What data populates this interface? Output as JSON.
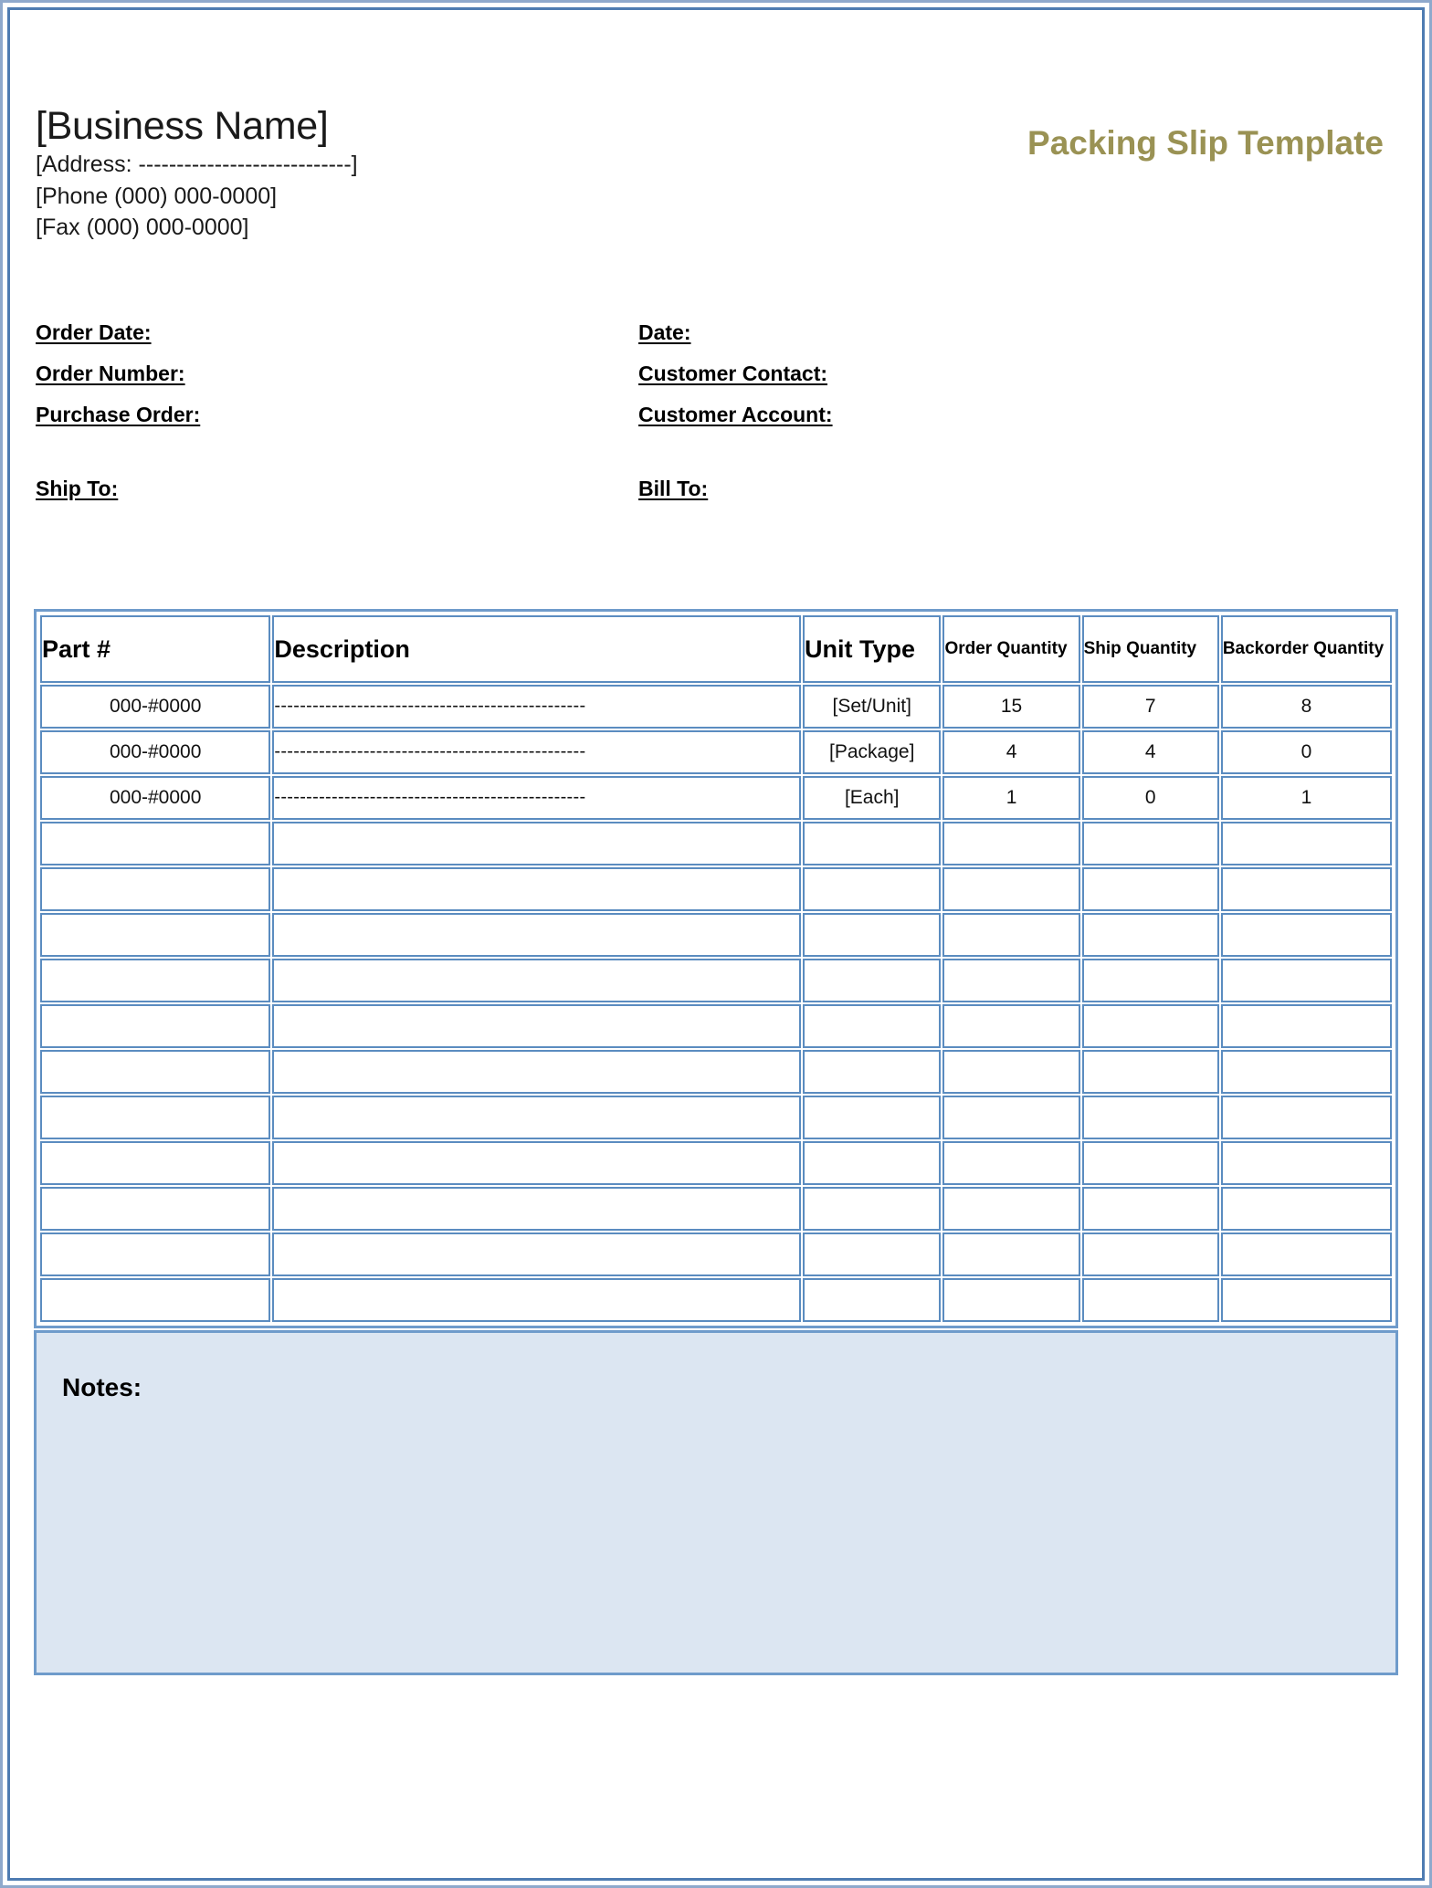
{
  "document": {
    "title": "Packing Slip Template",
    "title_color": "#9a9254"
  },
  "business": {
    "name": "[Business Name]",
    "address": "[Address: ----------------------------]",
    "phone": "[Phone (000) 000-0000]",
    "fax": "[Fax (000) 000-0000]"
  },
  "meta": {
    "left": [
      {
        "label": "Order Date:"
      },
      {
        "label": "Order Number:"
      },
      {
        "label": "Purchase Order:"
      }
    ],
    "right": [
      {
        "label": "Date:"
      },
      {
        "label": "Customer Contact:"
      },
      {
        "label": "Customer Account:"
      }
    ],
    "ship_to": "Ship To:",
    "bill_to": "Bill To:"
  },
  "items_table": {
    "headers": {
      "part": "Part #",
      "description": "Description",
      "unit_type": "Unit Type",
      "order_quantity": "Order Quantity",
      "ship_quantity": "Ship Quantity",
      "backorder_quantity": "Backorder Quantity"
    },
    "header_bg": "#93b4dc",
    "border_color": "#5b8cc0",
    "rows": [
      {
        "part": "000-#0000",
        "description": "-------------------------------------------------",
        "unit_type": "[Set/Unit]",
        "order_quantity": "15",
        "ship_quantity": "7",
        "backorder_quantity": "8"
      },
      {
        "part": "000-#0000",
        "description": "-------------------------------------------------",
        "unit_type": "[Package]",
        "order_quantity": "4",
        "ship_quantity": "4",
        "backorder_quantity": "0"
      },
      {
        "part": "000-#0000",
        "description": "-------------------------------------------------",
        "unit_type": "[Each]",
        "order_quantity": "1",
        "ship_quantity": "0",
        "backorder_quantity": "1"
      },
      {
        "part": "",
        "description": "",
        "unit_type": "",
        "order_quantity": "",
        "ship_quantity": "",
        "backorder_quantity": ""
      },
      {
        "part": "",
        "description": "",
        "unit_type": "",
        "order_quantity": "",
        "ship_quantity": "",
        "backorder_quantity": ""
      },
      {
        "part": "",
        "description": "",
        "unit_type": "",
        "order_quantity": "",
        "ship_quantity": "",
        "backorder_quantity": ""
      },
      {
        "part": "",
        "description": "",
        "unit_type": "",
        "order_quantity": "",
        "ship_quantity": "",
        "backorder_quantity": ""
      },
      {
        "part": "",
        "description": "",
        "unit_type": "",
        "order_quantity": "",
        "ship_quantity": "",
        "backorder_quantity": ""
      },
      {
        "part": "",
        "description": "",
        "unit_type": "",
        "order_quantity": "",
        "ship_quantity": "",
        "backorder_quantity": ""
      },
      {
        "part": "",
        "description": "",
        "unit_type": "",
        "order_quantity": "",
        "ship_quantity": "",
        "backorder_quantity": ""
      },
      {
        "part": "",
        "description": "",
        "unit_type": "",
        "order_quantity": "",
        "ship_quantity": "",
        "backorder_quantity": ""
      },
      {
        "part": "",
        "description": "",
        "unit_type": "",
        "order_quantity": "",
        "ship_quantity": "",
        "backorder_quantity": ""
      },
      {
        "part": "",
        "description": "",
        "unit_type": "",
        "order_quantity": "",
        "ship_quantity": "",
        "backorder_quantity": ""
      },
      {
        "part": "",
        "description": "",
        "unit_type": "",
        "order_quantity": "",
        "ship_quantity": "",
        "backorder_quantity": ""
      }
    ]
  },
  "notes": {
    "label": "Notes:",
    "value": "",
    "background": "#dce6f2"
  }
}
